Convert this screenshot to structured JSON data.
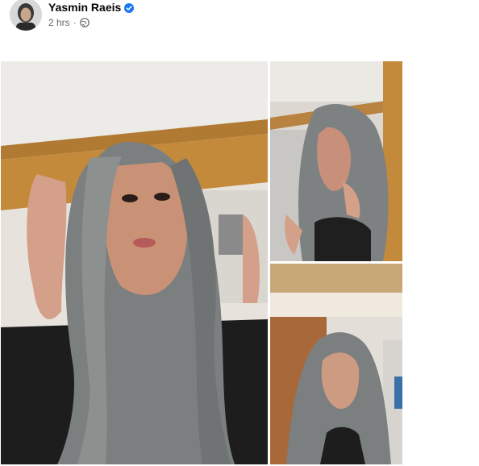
{
  "post": {
    "author_name": "Yasmin Raeis",
    "verified": true,
    "timestamp": "2 hrs",
    "separator": "·",
    "privacy_icon": "globe-icon"
  },
  "photos": [
    {
      "label": "photo-main"
    },
    {
      "label": "photo-side-top"
    },
    {
      "label": "photo-side-bottom"
    }
  ],
  "colors": {
    "author": "#050505",
    "meta": "#65676b",
    "verified_badge": "#1877f2",
    "hair": "#7b7f7f",
    "wood": "#c48a3c",
    "ceiling": "#e6e3dc"
  }
}
